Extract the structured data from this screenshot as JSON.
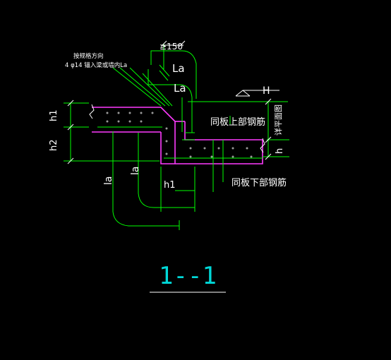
{
  "colors": {
    "background": "#000000",
    "rebar_green": "#00ff00",
    "slab_outline": "#ff3bff",
    "dim_white": "#ffffff",
    "title_cyan": "#00d8d8",
    "detail_dots": "#9a9a9a"
  },
  "labels": {
    "note_line1": "按规格方向",
    "note_line2": "4 φ14 锚入梁或墙内La",
    "dim_150": "≥150",
    "la_upper_1": "La",
    "la_upper_2": "La",
    "elevation": "H",
    "upper_rebar": "同板上部钢筋",
    "lower_rebar": "同板下部钢筋",
    "slab_side_note": "详平面图",
    "dim_h1_left": "h1",
    "dim_h2_left": "h2",
    "dim_h_right": "h",
    "la_lower_1": "la",
    "la_lower_2": "la",
    "dim_h1_bottom": "h1"
  },
  "title": {
    "text": "1--1"
  }
}
